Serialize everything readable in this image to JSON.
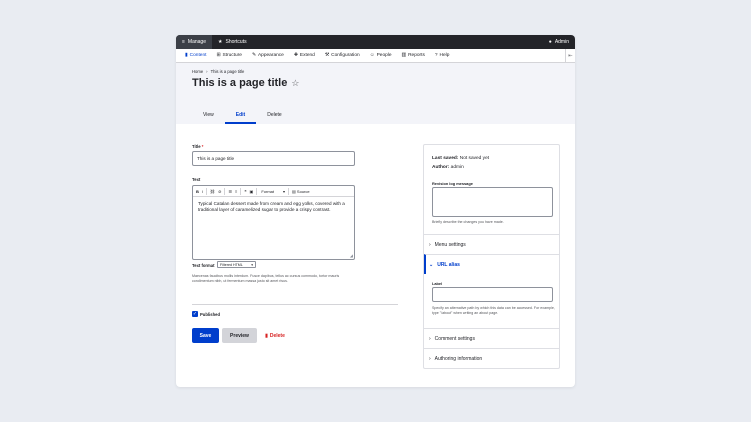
{
  "toolbar": {
    "manage_label": "Manage",
    "shortcuts_label": "Shortcuts",
    "admin_label": "Admin"
  },
  "tray": {
    "items": [
      {
        "label": "Content",
        "icon": "content-icon"
      },
      {
        "label": "Structure",
        "icon": "structure-icon"
      },
      {
        "label": "Appearance",
        "icon": "brush-icon"
      },
      {
        "label": "Extend",
        "icon": "puzzle-icon"
      },
      {
        "label": "Configuration",
        "icon": "wrench-icon"
      },
      {
        "label": "People",
        "icon": "people-icon"
      },
      {
        "label": "Reports",
        "icon": "chart-icon"
      },
      {
        "label": "Help",
        "icon": "help-icon"
      }
    ],
    "collapse_icon": "collapse-icon"
  },
  "header": {
    "breadcrumb": [
      "Home",
      "This is a page title"
    ],
    "breadcrumb_sep": "›",
    "title": "This is a page title",
    "tabs": [
      "View",
      "Edit",
      "Delete"
    ]
  },
  "form": {
    "title_label": "Title",
    "required_mark": "*",
    "title_value": "This is a page title",
    "text_label": "Text",
    "editor_toolbar": {
      "bold": "B",
      "italic": "I",
      "link": "⛓",
      "unlink": "⊘",
      "bullets": "☰",
      "numbered": "≡",
      "quote": "❝",
      "image": "▣",
      "format_label": "Format",
      "source_label": "Source"
    },
    "body_text": "Typical Catalan dessert made from cream and egg yolks, covered with a traditional layer of caramelized sugar to provide a crispy contrast.",
    "text_format_label": "Text format",
    "text_format_value": "Filtered HTML",
    "text_format_help": "Maecenas faucibus mollis interdum. Fusce dapibus, tellus ac cursus commodo, tortor mauris condimentum nibh, ut fermentum massa justo sit amet risus.",
    "published_label": "Published",
    "save_label": "Save",
    "preview_label": "Preview",
    "delete_label": "Delete"
  },
  "sidebar": {
    "last_saved_label": "Last saved:",
    "last_saved_value": "Not saved yet",
    "author_label": "Author:",
    "author_value": "admin",
    "revision_label": "Revision log message",
    "revision_help": "Briefly describe the changes you have made.",
    "menu_settings": "Menu settings",
    "url_alias": "URL alias",
    "alias_label": "Label",
    "alias_help": "Specify an alternative path by which this data can be accessed. For example, type \"/about\" when writing an about page.",
    "comment_settings": "Comment settings",
    "authoring_info": "Authoring information"
  },
  "colors": {
    "accent": "#003ecc",
    "toolbar_bg": "#232429",
    "danger": "#d72222",
    "background": "#e9ecf2"
  }
}
